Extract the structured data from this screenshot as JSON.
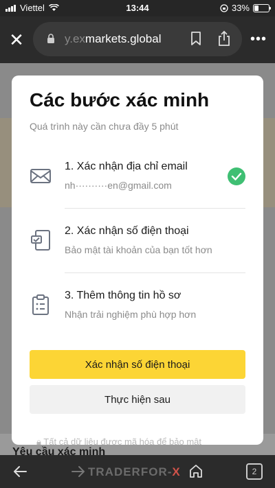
{
  "status_bar": {
    "carrier": "Viettel",
    "time": "13:44",
    "battery_percent": "33%",
    "battery_level": 0.33
  },
  "browser": {
    "url_faded": "y.ex",
    "url_main": "markets.global"
  },
  "modal": {
    "title": "Các bước xác minh",
    "subtitle": "Quá trình này cần chưa đầy 5 phút",
    "steps": [
      {
        "title": "1. Xác nhận địa chỉ email",
        "desc": "nh··········en@gmail.com",
        "icon": "envelope-icon",
        "done": true
      },
      {
        "title": "2. Xác nhận số điện thoại",
        "desc": "Bảo mật tài khoản của bạn tốt hơn",
        "icon": "phone-verify-icon",
        "done": false
      },
      {
        "title": "3. Thêm thông tin hồ sơ",
        "desc": "Nhận trải nghiệm phù hợp hơn",
        "icon": "clipboard-icon",
        "done": false
      }
    ],
    "primary_button": "Xác nhận số điện thoại",
    "secondary_button": "Thực hiện sau",
    "footer_note": "Tất cả dữ liệu được mã hóa để bảo mật"
  },
  "background_heading": "Yêu cầu xác minh",
  "bottom_bar": {
    "watermark_part1": "TRADER",
    "watermark_part2": "FOR",
    "watermark_sep": "-",
    "watermark_part3": "X",
    "tab_count": "2"
  },
  "colors": {
    "accent_yellow": "#fcd535",
    "success_green": "#3fbf73"
  }
}
